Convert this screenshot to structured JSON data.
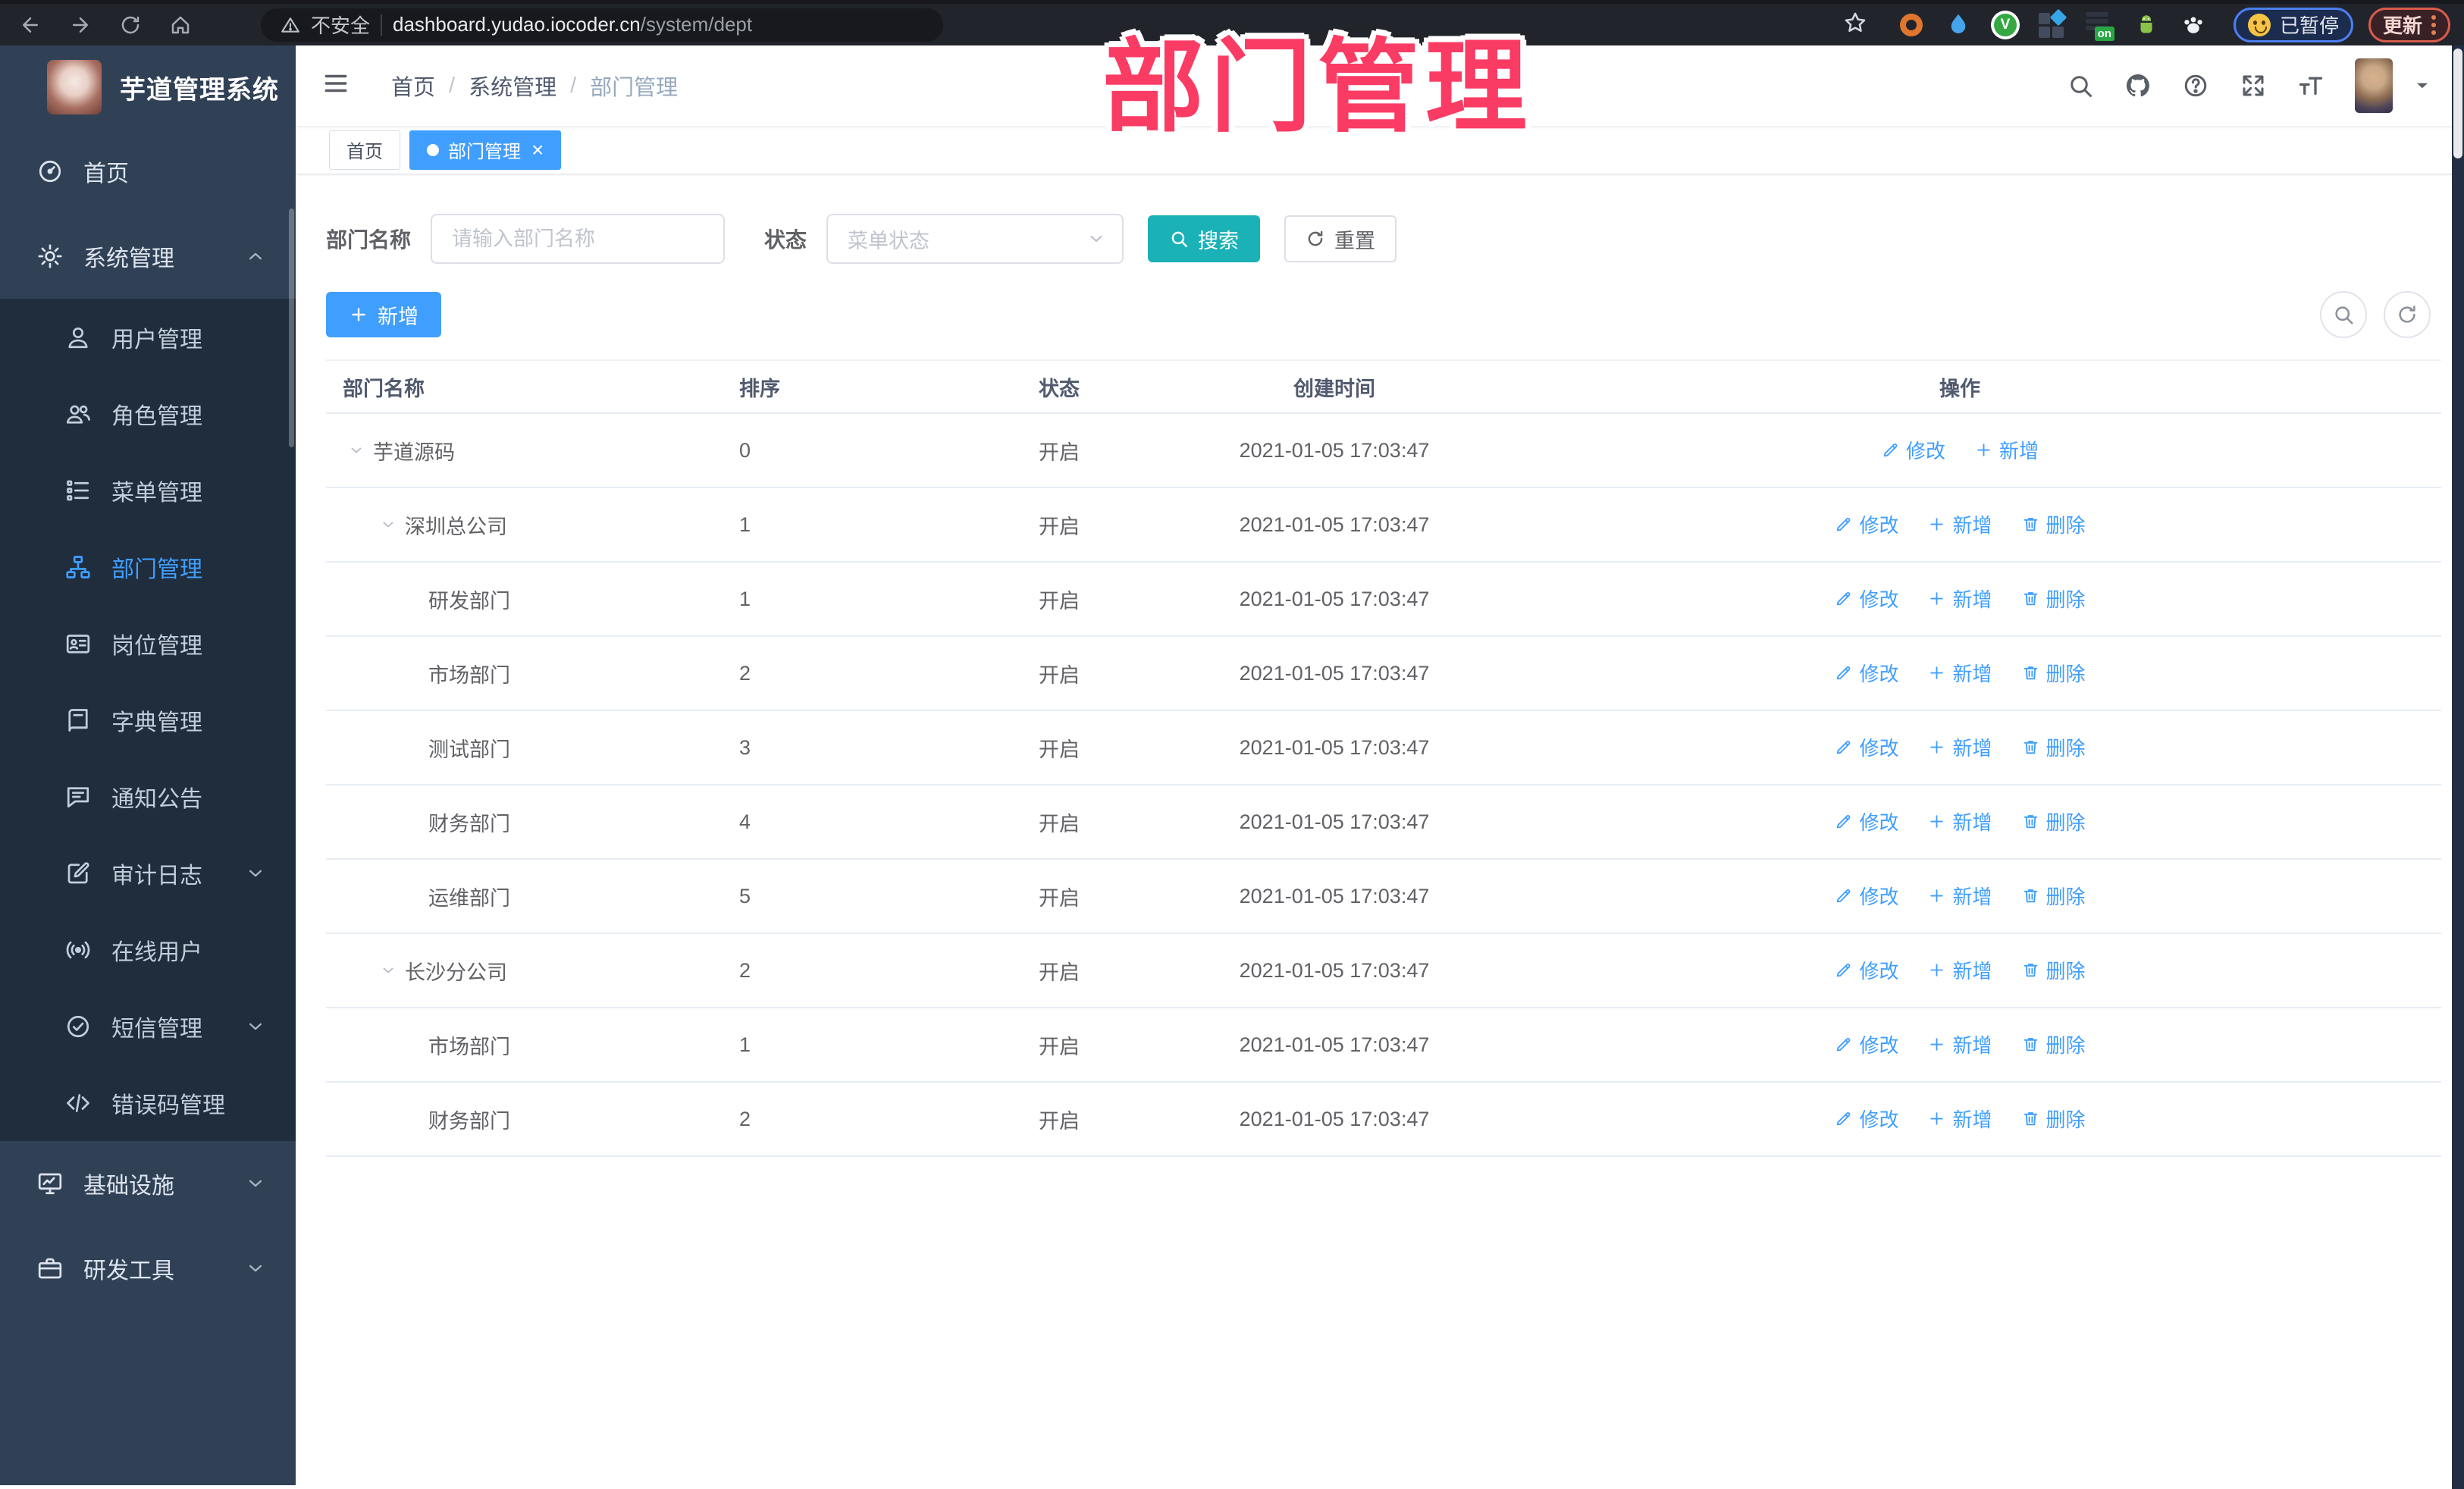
{
  "browser": {
    "security_label": "不安全",
    "url_domain": "dashboard.yudao.iocoder.cn",
    "url_path": "/system/dept",
    "paused_label": "已暂停",
    "update_label": "更新"
  },
  "annotation": {
    "title": "部门管理"
  },
  "sidebar": {
    "app_title": "芋道管理系统",
    "items": [
      {
        "id": "home",
        "label": "首页",
        "icon": "dashboard-icon",
        "level": "top"
      },
      {
        "id": "system",
        "label": "系统管理",
        "icon": "gear-icon",
        "level": "top",
        "chevron": "up",
        "expanded": true
      },
      {
        "id": "user",
        "label": "用户管理",
        "icon": "user-icon",
        "level": "sub"
      },
      {
        "id": "role",
        "label": "角色管理",
        "icon": "role-icon",
        "level": "sub"
      },
      {
        "id": "menu",
        "label": "菜单管理",
        "icon": "menu-tree-icon",
        "level": "sub"
      },
      {
        "id": "dept",
        "label": "部门管理",
        "icon": "org-chart-icon",
        "level": "sub",
        "active": true
      },
      {
        "id": "post",
        "label": "岗位管理",
        "icon": "id-card-icon",
        "level": "sub"
      },
      {
        "id": "dict",
        "label": "字典管理",
        "icon": "dictionary-icon",
        "level": "sub"
      },
      {
        "id": "notice",
        "label": "通知公告",
        "icon": "announcement-icon",
        "level": "sub"
      },
      {
        "id": "audit",
        "label": "审计日志",
        "icon": "audit-log-icon",
        "level": "sub",
        "chevron": "down"
      },
      {
        "id": "online",
        "label": "在线用户",
        "icon": "online-user-icon",
        "level": "sub"
      },
      {
        "id": "sms",
        "label": "短信管理",
        "icon": "sms-check-icon",
        "level": "sub",
        "chevron": "down"
      },
      {
        "id": "errcode",
        "label": "错误码管理",
        "icon": "error-code-icon",
        "level": "sub"
      },
      {
        "id": "infra",
        "label": "基础设施",
        "icon": "infrastructure-icon",
        "level": "top",
        "chevron": "down"
      },
      {
        "id": "tools",
        "label": "研发工具",
        "icon": "dev-tools-icon",
        "level": "top",
        "chevron": "down"
      }
    ]
  },
  "header": {
    "breadcrumb": [
      {
        "id": "home",
        "label": "首页"
      },
      {
        "id": "system",
        "label": "系统管理"
      },
      {
        "id": "dept",
        "label": "部门管理",
        "last": true
      }
    ]
  },
  "tabs": [
    {
      "id": "home",
      "label": "首页"
    },
    {
      "id": "dept",
      "label": "部门管理",
      "active": true,
      "closable": true
    }
  ],
  "filters": {
    "name_label": "部门名称",
    "name_placeholder": "请输入部门名称",
    "status_label": "状态",
    "status_placeholder": "菜单状态",
    "search_label": "搜索",
    "reset_label": "重置"
  },
  "toolbar": {
    "add_label": "新增"
  },
  "table": {
    "columns": [
      "部门名称",
      "排序",
      "状态",
      "创建时间",
      "操作"
    ],
    "action_labels": {
      "edit": "修改",
      "add": "新增",
      "del": "删除"
    },
    "rows": [
      {
        "name": "芋道源码",
        "indent": 0,
        "expandable": true,
        "sort": "0",
        "status": "开启",
        "created": "2021-01-05 17:03:47",
        "actions": [
          "edit",
          "add"
        ]
      },
      {
        "name": "深圳总公司",
        "indent": 1,
        "expandable": true,
        "sort": "1",
        "status": "开启",
        "created": "2021-01-05 17:03:47",
        "actions": [
          "edit",
          "add",
          "del"
        ]
      },
      {
        "name": "研发部门",
        "indent": 2,
        "expandable": false,
        "sort": "1",
        "status": "开启",
        "created": "2021-01-05 17:03:47",
        "actions": [
          "edit",
          "add",
          "del"
        ]
      },
      {
        "name": "市场部门",
        "indent": 2,
        "expandable": false,
        "sort": "2",
        "status": "开启",
        "created": "2021-01-05 17:03:47",
        "actions": [
          "edit",
          "add",
          "del"
        ]
      },
      {
        "name": "测试部门",
        "indent": 2,
        "expandable": false,
        "sort": "3",
        "status": "开启",
        "created": "2021-01-05 17:03:47",
        "actions": [
          "edit",
          "add",
          "del"
        ]
      },
      {
        "name": "财务部门",
        "indent": 2,
        "expandable": false,
        "sort": "4",
        "status": "开启",
        "created": "2021-01-05 17:03:47",
        "actions": [
          "edit",
          "add",
          "del"
        ]
      },
      {
        "name": "运维部门",
        "indent": 2,
        "expandable": false,
        "sort": "5",
        "status": "开启",
        "created": "2021-01-05 17:03:47",
        "actions": [
          "edit",
          "add",
          "del"
        ]
      },
      {
        "name": "长沙分公司",
        "indent": 1,
        "expandable": true,
        "sort": "2",
        "status": "开启",
        "created": "2021-01-05 17:03:47",
        "actions": [
          "edit",
          "add",
          "del"
        ]
      },
      {
        "name": "市场部门",
        "indent": 2,
        "expandable": false,
        "sort": "1",
        "status": "开启",
        "created": "2021-01-05 17:03:47",
        "actions": [
          "edit",
          "add",
          "del"
        ]
      },
      {
        "name": "财务部门",
        "indent": 2,
        "expandable": false,
        "sort": "2",
        "status": "开启",
        "created": "2021-01-05 17:03:47",
        "actions": [
          "edit",
          "add",
          "del"
        ]
      }
    ]
  },
  "colors": {
    "primary": "#409eff",
    "search_button": "#1ab2b7",
    "sidebar_bg": "#304156",
    "submenu_bg": "#1f2d3d",
    "annotation": "#fa3c64",
    "status_text": "#606266"
  }
}
